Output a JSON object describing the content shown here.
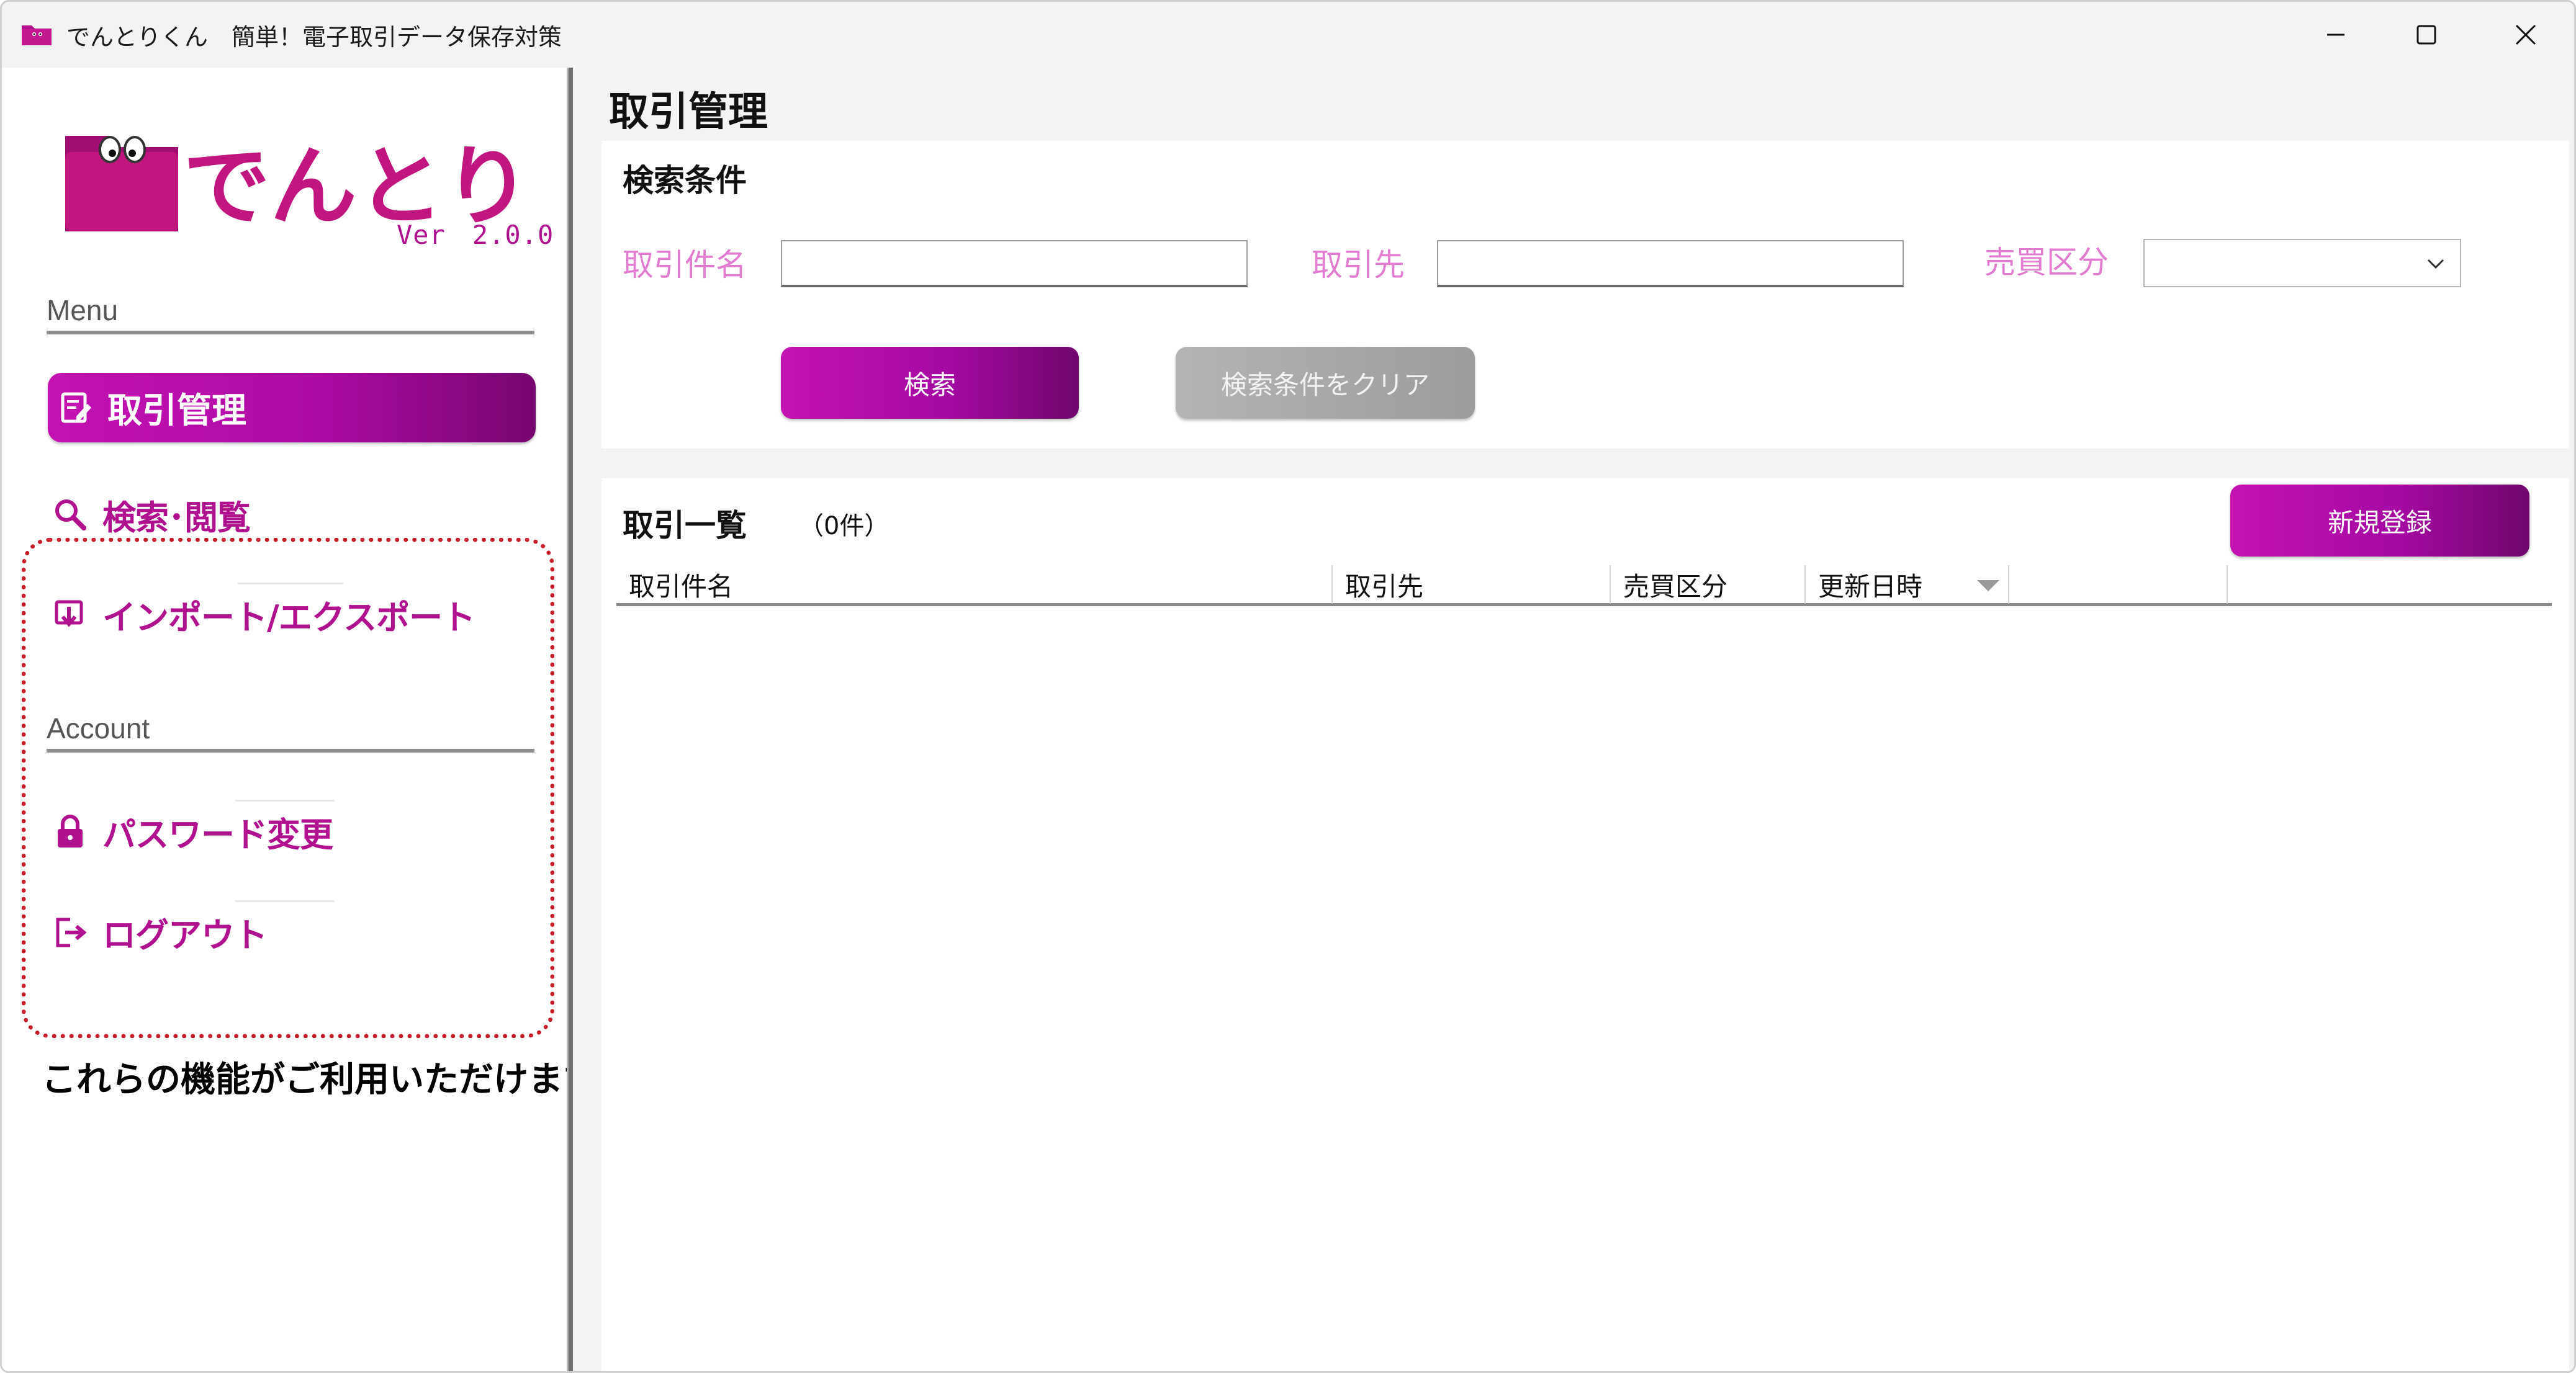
{
  "window": {
    "title": "でんとりくん　簡単！電子取引データ保存対策",
    "controls": {
      "minimize": "minimize",
      "maximize": "maximize",
      "close": "close"
    }
  },
  "sidebar": {
    "logo_text": "でんとりくん",
    "version": "Ver　2.0.0",
    "menu_heading": "Menu",
    "account_heading": "Account",
    "menu_items": [
      {
        "label": "取引管理",
        "icon": "edit-document-icon",
        "active": true
      },
      {
        "label": "検索･閲覧",
        "icon": "search-icon",
        "active": false
      },
      {
        "label": "インポート/エクスポート",
        "icon": "import-export-icon",
        "active": false
      }
    ],
    "account_items": [
      {
        "label": "パスワード変更",
        "icon": "lock-icon"
      },
      {
        "label": "ログアウト",
        "icon": "logout-icon"
      }
    ],
    "note": "これらの機能がご利用いただけます"
  },
  "main": {
    "page_title": "取引管理",
    "search": {
      "heading": "検索条件",
      "fields": {
        "transaction_name": {
          "label": "取引件名",
          "value": ""
        },
        "partner": {
          "label": "取引先",
          "value": ""
        },
        "trade_type": {
          "label": "売買区分",
          "selected": ""
        }
      },
      "search_button": "検索",
      "clear_button": "検索条件をクリア"
    },
    "list": {
      "heading": "取引一覧",
      "count": "（0件）",
      "new_button": "新規登録",
      "columns": [
        "取引件名",
        "取引先",
        "売買区分",
        "更新日時",
        "",
        ""
      ],
      "rows": []
    }
  },
  "colors": {
    "accent": "#b0118f",
    "accent_gradient_start": "#c412b2",
    "accent_gradient_end": "#70066c",
    "field_label": "#e17cd1",
    "annotation_box": "#c81e2a",
    "disabled_button": "#a8a8a8"
  }
}
